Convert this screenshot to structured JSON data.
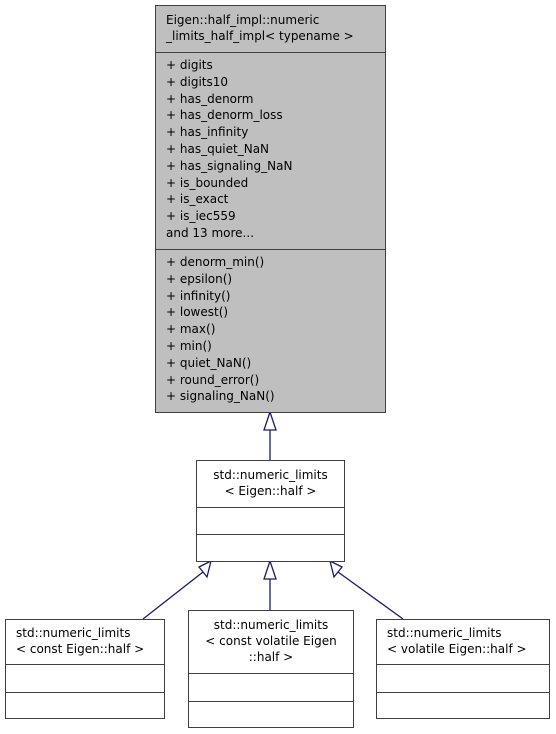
{
  "diagram": {
    "type": "inheritance-graph",
    "edge_color": "#191970",
    "base_class": {
      "title_line1": "Eigen::half_impl::numeric",
      "title_line2": "_limits_half_impl< typename >",
      "attributes": [
        "+ digits",
        "+ digits10",
        "+ has_denorm",
        "+ has_denorm_loss",
        "+ has_infinity",
        "+ has_quiet_NaN",
        "+ has_signaling_NaN",
        "+ is_bounded",
        "+ is_exact",
        "+ is_iec559",
        "and 13 more..."
      ],
      "methods": [
        "+ denorm_min()",
        "+ epsilon()",
        "+ infinity()",
        "+ lowest()",
        "+ max()",
        "+ min()",
        "+ quiet_NaN()",
        "+ round_error()",
        "+ signaling_NaN()"
      ],
      "fill": "#bfbfbf"
    },
    "middle_class": {
      "title_line1": "std::numeric_limits",
      "title_line2": "< Eigen::half >"
    },
    "derived_classes": [
      {
        "title_line1": "std::numeric_limits",
        "title_line2": "< const Eigen::half >",
        "title_line3": ""
      },
      {
        "title_line1": "std::numeric_limits",
        "title_line2": "< const volatile Eigen",
        "title_line3": "::half >"
      },
      {
        "title_line1": "std::numeric_limits",
        "title_line2": "< volatile Eigen::half >",
        "title_line3": ""
      }
    ]
  }
}
